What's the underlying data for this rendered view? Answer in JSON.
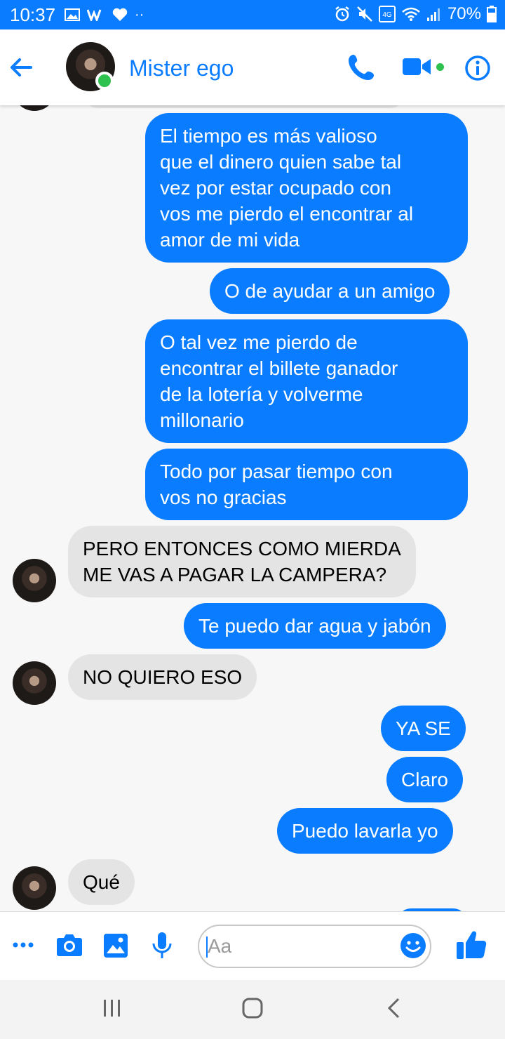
{
  "status_bar": {
    "time": "10:37",
    "battery": "70%",
    "network": "Vo) 4G"
  },
  "header": {
    "contact_name": "Mister ego"
  },
  "messages": [
    {
      "direction": "sent",
      "text": "El tiempo es más valioso\nque el dinero quien sabe tal\nvez por estar ocupado con\nvos me pierdo el encontrar al\namor de mi vida"
    },
    {
      "direction": "sent",
      "text": "O de ayudar a un amigo"
    },
    {
      "direction": "sent",
      "text": "O tal vez me pierdo de\nencontrar el billete ganador\nde la lotería y volverme\nmillonario"
    },
    {
      "direction": "sent",
      "text": "Todo por pasar tiempo con\nvos no gracias"
    },
    {
      "direction": "received",
      "text": "PERO ENTONCES COMO MIERDA\nME VAS A PAGAR LA CAMPERA?"
    },
    {
      "direction": "sent",
      "text": "Te puedo dar agua y jabón"
    },
    {
      "direction": "received",
      "text": "NO QUIERO ESO"
    },
    {
      "direction": "sent",
      "text": "YA SE"
    },
    {
      "direction": "sent",
      "text": "Claro"
    },
    {
      "direction": "sent",
      "text": "Puedo lavarla yo"
    },
    {
      "direction": "received",
      "text": "Qué"
    }
  ],
  "composer": {
    "placeholder": "Aa"
  },
  "colors": {
    "accent": "#0a7cff",
    "online": "#2ec14e",
    "received_bubble": "#e4e4e4"
  },
  "icons": [
    "back-arrow-icon",
    "phone-icon",
    "video-camera-icon",
    "info-icon",
    "more-dots-icon",
    "camera-icon",
    "image-icon",
    "microphone-icon",
    "emoji-icon",
    "thumbs-up-icon"
  ]
}
